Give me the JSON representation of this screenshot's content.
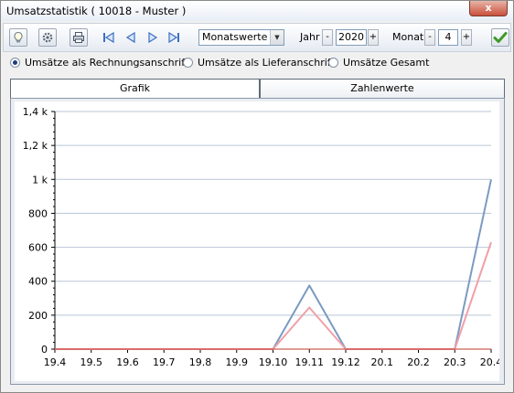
{
  "window": {
    "title": "Umsatzstatistik ( 10018 - Muster )",
    "close_label": "x"
  },
  "toolbar": {
    "icons": [
      "lightbulb-icon",
      "settings-icon",
      "print-icon",
      "first-icon",
      "prev-icon",
      "next-icon",
      "last-icon"
    ],
    "period_select": "Monatswerte",
    "year_label": "Jahr",
    "year_value": "2020",
    "month_label": "Monat",
    "month_value": "4",
    "minus": "-",
    "plus": "+"
  },
  "radios": [
    {
      "label": "Umsätze als Rechnungsanschrift",
      "selected": true
    },
    {
      "label": "Umsätze als Lieferanschrift",
      "selected": false
    },
    {
      "label": "Umsätze Gesamt",
      "selected": false
    }
  ],
  "tabs": [
    {
      "label": "Grafik",
      "active": true
    },
    {
      "label": "Zahlenwerte",
      "active": false
    }
  ],
  "colors": {
    "series1": "#7b9ac2",
    "series2": "#f0a0a8",
    "grid": "#b9c6d6"
  },
  "chart_data": {
    "type": "line",
    "title": "",
    "xlabel": "",
    "ylabel": "",
    "categories": [
      "19.4",
      "19.5",
      "19.6",
      "19.7",
      "19.8",
      "19.9",
      "19.10",
      "19.11",
      "19.12",
      "20.1",
      "20.2",
      "20.3",
      "20.4"
    ],
    "yticks": [
      0,
      200,
      400,
      600,
      800,
      1000,
      1200,
      1400
    ],
    "ytick_labels": [
      "0",
      "200",
      "400",
      "600",
      "800",
      "1 k",
      "1,2 k",
      "1,4 k"
    ],
    "ylim": [
      0,
      1400
    ],
    "grid": true,
    "series": [
      {
        "values": [
          0,
          0,
          0,
          0,
          0,
          0,
          0,
          375,
          0,
          0,
          0,
          0,
          1000
        ],
        "color": "#7b9ac2"
      },
      {
        "values": [
          0,
          0,
          0,
          0,
          0,
          0,
          0,
          245,
          0,
          0,
          0,
          0,
          630
        ],
        "color": "#f0a0a8"
      }
    ]
  }
}
